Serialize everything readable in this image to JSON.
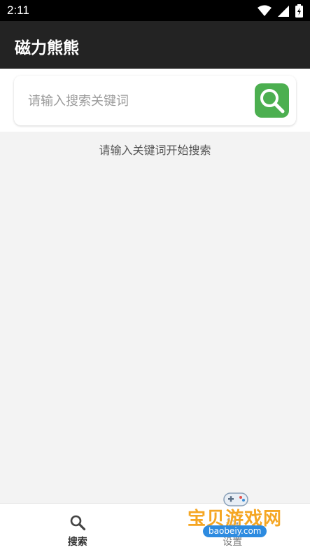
{
  "status_bar": {
    "time": "2:11",
    "icons": [
      "wifi-icon",
      "signal-icon",
      "battery-icon"
    ]
  },
  "app": {
    "title": "磁力熊熊"
  },
  "search": {
    "placeholder": "请输入搜索关键词",
    "value": "",
    "button_icon": "search-icon",
    "button_color": "#4caf50"
  },
  "main": {
    "hint": "请输入关键词开始搜索"
  },
  "bottom_nav": {
    "items": [
      {
        "label": "搜索",
        "icon": "search-icon",
        "active": true
      },
      {
        "label": "设置",
        "icon": "settings-icon",
        "active": false
      }
    ]
  },
  "watermark": {
    "text": "宝贝游戏网",
    "domain": "baobeiy.com"
  },
  "colors": {
    "app_bar": "#232323",
    "accent": "#4caf50",
    "background": "#f3f3f3"
  }
}
